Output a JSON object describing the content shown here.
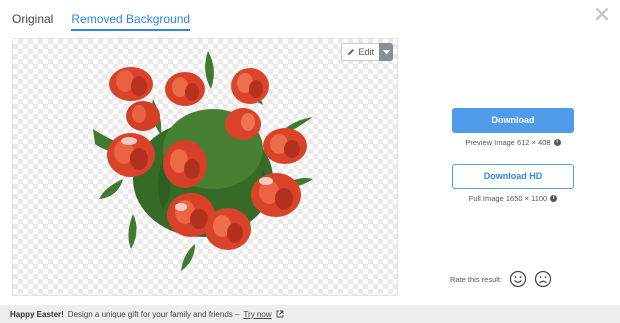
{
  "tabs": [
    {
      "label": "Original",
      "active": false
    },
    {
      "label": "Removed Background",
      "active": true
    }
  ],
  "editor": {
    "edit_label": "Edit"
  },
  "download": {
    "label": "Download",
    "preview_text": "Preview Image 612 × 408"
  },
  "download_hd": {
    "label": "Download HD",
    "full_text": "Full Image 1650 × 1100"
  },
  "rating": {
    "label": "Rate this result:"
  },
  "promo": {
    "headline": "Happy Easter!",
    "text": "Design a unique gift for your family and friends –",
    "link": "Try now"
  },
  "colors": {
    "accent": "#4f9bea",
    "link": "#2f86e6",
    "flower": "#d9432a",
    "leaf": "#3f7a2e"
  },
  "icons": [
    "close-icon",
    "pencil-icon",
    "chevron-down-icon",
    "info-icon",
    "smile-icon",
    "frown-icon",
    "external-link-icon"
  ]
}
